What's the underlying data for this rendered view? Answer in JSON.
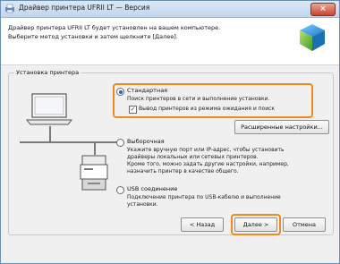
{
  "window": {
    "title": "Драйвер принтера UFRII LT — Версия",
    "close_label": "×"
  },
  "header": {
    "line1": "Драйвер принтера UFRII LT будет установлен на вашем компьютере.",
    "line2": "Выберите метод установки и затем щелкните [Далее]."
  },
  "group": {
    "label": "Установка принтера"
  },
  "options": {
    "standard": {
      "title": "Стандартная",
      "desc": "Поиск принтеров в сети и выполнение установки.",
      "checkbox_label": "Вывод принтеров из режима ожидания и поиск",
      "checked": true
    },
    "advanced_button": "Расширенные настройки...",
    "custom": {
      "title": "Выборочная",
      "desc": [
        "Укажите вручную порт или IP-адрес, чтобы установить",
        "драйверы локальных или сетевых принтеров.",
        "Кроме того, можно задать другие настройки, например,",
        "назначить принтер в качестве общего."
      ]
    },
    "usb": {
      "title": "USB соединение",
      "desc": [
        "Подключение принтера по USB-кабелю и выполнение",
        "установки."
      ]
    }
  },
  "footer": {
    "back": "< Назад",
    "next": "Далее >",
    "cancel": "Отмена"
  },
  "colors": {
    "highlight": "#f08a1c",
    "accent": "#2b5fb0"
  }
}
